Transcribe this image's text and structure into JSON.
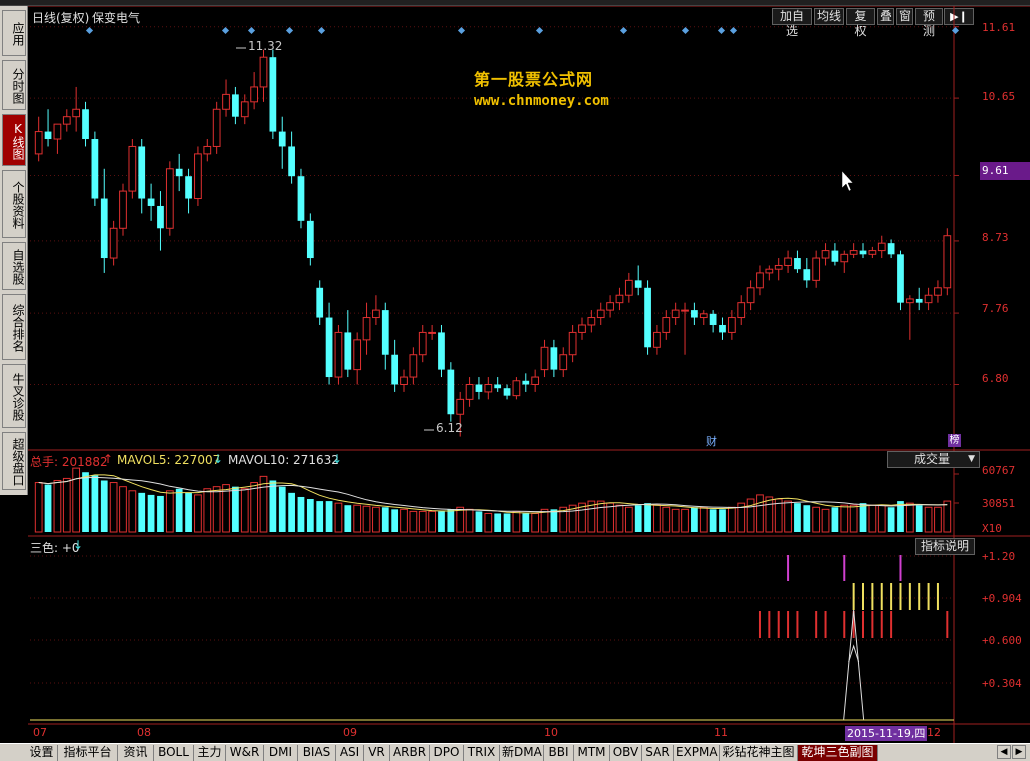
{
  "header": {
    "period": "日线(复权)",
    "stock_name": "保变电气",
    "buttons": [
      "加自选",
      "均线",
      "复权",
      "叠",
      "窗",
      "预测"
    ]
  },
  "sidebar": {
    "items": [
      {
        "label": "应用",
        "active": false
      },
      {
        "label": "分时图",
        "active": false
      },
      {
        "label": "K线图",
        "active": true
      },
      {
        "label": "个股资料",
        "active": false
      },
      {
        "label": "自选股",
        "active": false
      },
      {
        "label": "综合排名",
        "active": false
      },
      {
        "label": "牛叉诊股",
        "active": false
      },
      {
        "label": "超级盘口",
        "active": false
      }
    ]
  },
  "watermark": {
    "title": "第一股票公式网",
    "url": "www.chnmoney.com"
  },
  "price_axis": {
    "labels": [
      "11.61",
      "10.65",
      "9.61",
      "8.73",
      "7.76",
      "6.80"
    ],
    "current": "9.61"
  },
  "annotations": {
    "high": "11.32",
    "low": "6.12",
    "marker_cai": "财",
    "marker_bang": "榜"
  },
  "volume_panel": {
    "total_label": "总手: 201882",
    "mavol5": "MAVOL5: 227007",
    "mavol10": "MAVOL10: 271632",
    "selector": "成交量",
    "axis": [
      "60767",
      "30851",
      "X10"
    ]
  },
  "indicator_panel": {
    "label": "三色: +0",
    "help": "指标说明",
    "axis": [
      "+1.20",
      "+0.904",
      "+0.600",
      "+0.304"
    ]
  },
  "date_axis": {
    "months": [
      "07",
      "08",
      "09",
      "10",
      "11",
      "12"
    ],
    "cursor_date": "2015-11-19,四"
  },
  "tabs": [
    {
      "label": "设置",
      "active": false
    },
    {
      "label": "指标平台",
      "active": false
    },
    {
      "label": "资讯",
      "active": false
    },
    {
      "label": "BOLL",
      "active": false
    },
    {
      "label": "主力",
      "active": false
    },
    {
      "label": "W&R",
      "active": false
    },
    {
      "label": "DMI",
      "active": false
    },
    {
      "label": "BIAS",
      "active": false
    },
    {
      "label": "ASI",
      "active": false
    },
    {
      "label": "VR",
      "active": false
    },
    {
      "label": "ARBR",
      "active": false
    },
    {
      "label": "DPO",
      "active": false
    },
    {
      "label": "TRIX",
      "active": false
    },
    {
      "label": "新DMA",
      "active": false
    },
    {
      "label": "BBI",
      "active": false
    },
    {
      "label": "MTM",
      "active": false
    },
    {
      "label": "OBV",
      "active": false
    },
    {
      "label": "SAR",
      "active": false
    },
    {
      "label": "EXPMA",
      "active": false
    },
    {
      "label": "彩钻花神主图",
      "active": false
    },
    {
      "label": "乾坤三色副图",
      "active": true
    }
  ],
  "chart_data": {
    "type": "candlestick",
    "candles": [
      [
        9.9,
        10.4,
        9.8,
        10.2
      ],
      [
        10.2,
        10.5,
        10.0,
        10.1
      ],
      [
        10.1,
        10.3,
        9.9,
        10.3
      ],
      [
        10.3,
        10.5,
        10.2,
        10.4
      ],
      [
        10.4,
        10.8,
        10.2,
        10.5
      ],
      [
        10.5,
        10.6,
        10.0,
        10.1
      ],
      [
        10.1,
        10.2,
        9.2,
        9.3
      ],
      [
        9.3,
        9.7,
        8.3,
        8.5
      ],
      [
        8.5,
        9.0,
        8.4,
        8.9
      ],
      [
        8.9,
        9.5,
        8.8,
        9.4
      ],
      [
        9.4,
        10.1,
        9.3,
        10.0
      ],
      [
        10.0,
        10.1,
        9.1,
        9.3
      ],
      [
        9.3,
        9.5,
        9.0,
        9.2
      ],
      [
        9.2,
        9.4,
        8.6,
        8.9
      ],
      [
        8.9,
        9.8,
        8.8,
        9.7
      ],
      [
        9.7,
        9.9,
        9.4,
        9.6
      ],
      [
        9.6,
        9.7,
        9.1,
        9.3
      ],
      [
        9.3,
        10.0,
        9.2,
        9.9
      ],
      [
        9.9,
        10.1,
        9.8,
        10.0
      ],
      [
        10.0,
        10.6,
        9.9,
        10.5
      ],
      [
        10.5,
        10.9,
        10.4,
        10.7
      ],
      [
        10.7,
        10.8,
        10.3,
        10.4
      ],
      [
        10.4,
        10.7,
        10.3,
        10.6
      ],
      [
        10.6,
        11.0,
        10.5,
        10.8
      ],
      [
        10.8,
        11.3,
        10.6,
        11.2
      ],
      [
        11.2,
        11.3,
        10.1,
        10.2
      ],
      [
        10.2,
        10.4,
        9.7,
        10.0
      ],
      [
        10.0,
        10.2,
        9.5,
        9.6
      ],
      [
        9.6,
        9.7,
        8.9,
        9.0
      ],
      [
        9.0,
        9.1,
        8.4,
        8.5
      ],
      [
        8.1,
        8.2,
        7.6,
        7.7
      ],
      [
        7.7,
        7.9,
        6.8,
        6.9
      ],
      [
        6.9,
        7.6,
        6.8,
        7.5
      ],
      [
        7.5,
        7.8,
        6.9,
        7.0
      ],
      [
        7.0,
        7.5,
        6.8,
        7.4
      ],
      [
        7.4,
        7.9,
        7.2,
        7.7
      ],
      [
        7.7,
        8.0,
        7.6,
        7.8
      ],
      [
        7.8,
        7.9,
        7.0,
        7.2
      ],
      [
        7.2,
        7.4,
        6.7,
        6.8
      ],
      [
        6.8,
        7.0,
        6.7,
        6.9
      ],
      [
        6.9,
        7.3,
        6.8,
        7.2
      ],
      [
        7.2,
        7.6,
        7.1,
        7.5
      ],
      [
        7.5,
        7.6,
        7.4,
        7.5
      ],
      [
        7.5,
        7.6,
        6.9,
        7.0
      ],
      [
        7.0,
        7.1,
        6.3,
        6.4
      ],
      [
        6.4,
        6.7,
        6.1,
        6.6
      ],
      [
        6.6,
        6.9,
        6.5,
        6.8
      ],
      [
        6.8,
        6.9,
        6.6,
        6.7
      ],
      [
        6.7,
        6.9,
        6.6,
        6.8
      ],
      [
        6.8,
        6.9,
        6.7,
        6.75
      ],
      [
        6.75,
        6.8,
        6.6,
        6.65
      ],
      [
        6.65,
        6.9,
        6.6,
        6.85
      ],
      [
        6.85,
        6.95,
        6.7,
        6.8
      ],
      [
        6.8,
        7.0,
        6.7,
        6.9
      ],
      [
        7.0,
        7.4,
        6.9,
        7.3
      ],
      [
        7.3,
        7.4,
        6.9,
        7.0
      ],
      [
        7.0,
        7.3,
        6.9,
        7.2
      ],
      [
        7.2,
        7.6,
        7.1,
        7.5
      ],
      [
        7.5,
        7.7,
        7.4,
        7.6
      ],
      [
        7.6,
        7.8,
        7.5,
        7.7
      ],
      [
        7.7,
        7.9,
        7.6,
        7.8
      ],
      [
        7.8,
        8.0,
        7.7,
        7.9
      ],
      [
        7.9,
        8.1,
        7.8,
        8.0
      ],
      [
        8.0,
        8.3,
        7.9,
        8.2
      ],
      [
        8.2,
        8.4,
        8.0,
        8.1
      ],
      [
        8.1,
        8.2,
        7.2,
        7.3
      ],
      [
        7.3,
        7.6,
        7.2,
        7.5
      ],
      [
        7.5,
        7.8,
        7.4,
        7.7
      ],
      [
        7.7,
        7.9,
        7.6,
        7.8
      ],
      [
        7.8,
        7.9,
        7.2,
        7.8
      ],
      [
        7.8,
        7.9,
        7.6,
        7.7
      ],
      [
        7.7,
        7.8,
        7.6,
        7.75
      ],
      [
        7.75,
        7.8,
        7.5,
        7.6
      ],
      [
        7.6,
        7.7,
        7.4,
        7.5
      ],
      [
        7.5,
        7.8,
        7.4,
        7.7
      ],
      [
        7.7,
        8.0,
        7.6,
        7.9
      ],
      [
        7.9,
        8.2,
        7.8,
        8.1
      ],
      [
        8.1,
        8.4,
        8.0,
        8.3
      ],
      [
        8.3,
        8.4,
        8.2,
        8.35
      ],
      [
        8.35,
        8.5,
        8.2,
        8.4
      ],
      [
        8.4,
        8.6,
        8.3,
        8.5
      ],
      [
        8.5,
        8.6,
        8.3,
        8.35
      ],
      [
        8.35,
        8.5,
        8.1,
        8.2
      ],
      [
        8.2,
        8.6,
        8.1,
        8.5
      ],
      [
        8.5,
        8.7,
        8.4,
        8.6
      ],
      [
        8.6,
        8.7,
        8.4,
        8.45
      ],
      [
        8.45,
        8.6,
        8.3,
        8.55
      ],
      [
        8.55,
        8.7,
        8.5,
        8.6
      ],
      [
        8.6,
        8.7,
        8.5,
        8.55
      ],
      [
        8.55,
        8.65,
        8.5,
        8.6
      ],
      [
        8.6,
        8.8,
        8.5,
        8.7
      ],
      [
        8.7,
        8.75,
        8.5,
        8.55
      ],
      [
        8.55,
        8.6,
        7.8,
        7.9
      ],
      [
        7.9,
        8.0,
        7.4,
        7.95
      ],
      [
        7.95,
        8.1,
        7.8,
        7.9
      ],
      [
        7.9,
        8.1,
        7.8,
        8.0
      ],
      [
        8.0,
        8.2,
        7.9,
        8.1
      ],
      [
        8.1,
        8.9,
        8.0,
        8.8
      ]
    ],
    "volume": [
      48,
      46,
      50,
      52,
      62,
      58,
      55,
      50,
      48,
      44,
      40,
      38,
      36,
      35,
      40,
      42,
      38,
      36,
      42,
      44,
      46,
      44,
      42,
      48,
      54,
      50,
      44,
      38,
      34,
      32,
      30,
      30,
      28,
      26,
      26,
      25,
      24,
      24,
      22,
      22,
      20,
      20,
      20,
      20,
      22,
      24,
      22,
      20,
      18,
      18,
      18,
      20,
      18,
      18,
      22,
      22,
      24,
      26,
      28,
      30,
      30,
      28,
      26,
      24,
      26,
      28,
      26,
      24,
      22,
      22,
      24,
      24,
      22,
      22,
      24,
      28,
      32,
      36,
      34,
      32,
      30,
      28,
      26,
      24,
      22,
      24,
      26,
      26,
      28,
      26,
      26,
      24,
      30,
      28,
      26,
      24,
      24,
      30
    ],
    "indicator": {
      "magenta": [
        80,
        86,
        92
      ],
      "yellow": [
        87,
        88,
        89,
        90,
        91,
        92,
        93,
        94,
        95,
        96
      ],
      "red": [
        77,
        78,
        79,
        80,
        81,
        83,
        84,
        86,
        87,
        88,
        89,
        90,
        91,
        97
      ],
      "spike_at": 87
    }
  }
}
